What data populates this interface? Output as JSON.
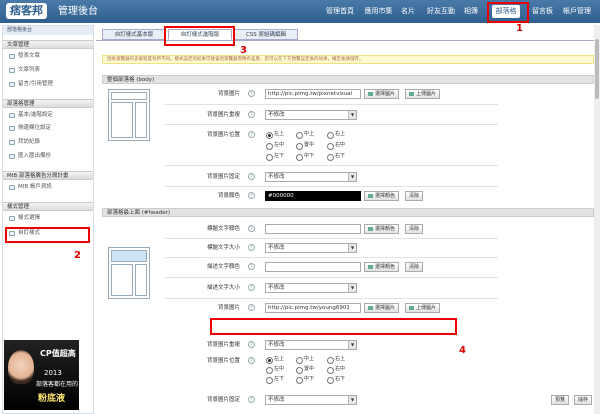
{
  "header": {
    "logo": "痞客邦",
    "title": "管理後台",
    "nav": [
      "管理首頁",
      "應用市集",
      "名片",
      "好友互動",
      "相簿",
      "部落格",
      "留言板",
      "帳戶管理"
    ],
    "active_nav": "部落格"
  },
  "annotations": [
    "1",
    "2",
    "3",
    "4"
  ],
  "sidebar": {
    "top": "部落格後台",
    "sections": [
      {
        "title": "文章管理",
        "items": [
          "發表文章",
          "文章列表",
          "留言/引用管理"
        ]
      },
      {
        "title": "部落格管理",
        "items": [
          "基本/進階設定",
          "側邊欄位設定",
          "拜訪紀錄",
          "匯入匯出備份"
        ]
      },
      {
        "title": "MIB 部落格廣告分潤計畫",
        "items": [
          "MIB 帳戶資訊"
        ]
      },
      {
        "title": "樣式管理",
        "items": [
          "樣式選擇",
          "自訂樣式"
        ]
      }
    ]
  },
  "ad": {
    "line1": "CP值超高",
    "line2": "2013",
    "line3": "部落客都在用的",
    "line4": "粉底液"
  },
  "tabs": [
    "自訂樣式基本版",
    "自訂樣式進階版",
    "CSS 原始碼編輯"
  ],
  "active_tab": "自訂樣式進階版",
  "notice": "因各瀏覽器的支援程度有所不同，樣式設定的結果可能會因瀏覽器而略有差異，您可以在下方預覽設定後的效果，確定後請儲存。",
  "sections": [
    {
      "title": "整個部落格 (body)",
      "fields": {
        "bg_image_label": "背景圖片",
        "bg_image_value": "http://pic.pimg.tw/pixnetvisual",
        "bg_repeat_label": "背景圖片重複",
        "bg_position_label": "背景圖片位置",
        "bg_fixed_label": "背景圖片固定",
        "bg_color_label": "背景顏色",
        "bg_color_value": "#000000"
      }
    },
    {
      "title": "部落格最上面 (#header)",
      "fields": {
        "title_color_label": "標題文字顏色",
        "title_size_label": "標題文字大小",
        "desc_color_label": "描述文字顏色",
        "desc_size_label": "描述文字大小",
        "bg_image_label": "背景圖片",
        "bg_image_value": "http://pic.pimg.tw/young6901",
        "bg_repeat_label": "背景圖片重複",
        "bg_position_label": "背景圖片位置",
        "bg_fixed_label": "背景圖片固定"
      }
    }
  ],
  "select_default": "不修改",
  "positions": [
    "左上",
    "中上",
    "右上",
    "左中",
    "置中",
    "右中",
    "左下",
    "中下",
    "右下"
  ],
  "buttons": {
    "choose_image": "選擇圖片",
    "upload_image": "上傳圖片",
    "choose_color": "選擇顏色",
    "clear": "清除",
    "preview": "預覽",
    "save": "儲存"
  },
  "colors": {
    "topbar": "#2f5f8e",
    "annotation": "#e00000"
  }
}
